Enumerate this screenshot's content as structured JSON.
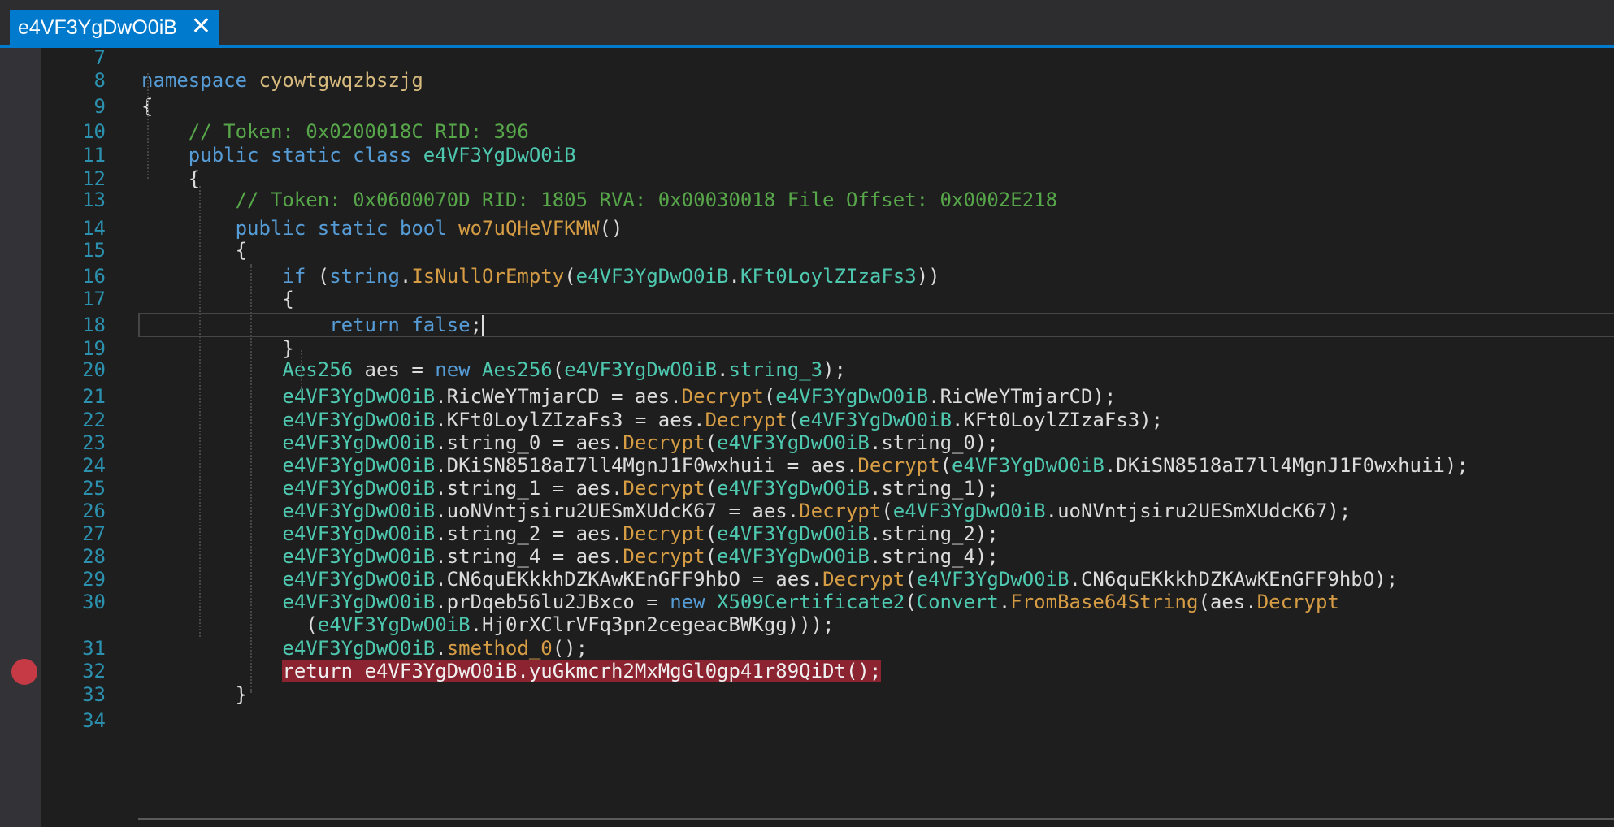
{
  "tab": {
    "title": "e4VF3YgDwO0iB",
    "close_glyph": "✕"
  },
  "editor": {
    "current_line": "18",
    "breakpoint_line": "32",
    "lines": [
      {
        "n": "7",
        "tokens": []
      },
      {
        "n": "8",
        "tokens": [
          [
            "kw",
            "namespace "
          ],
          [
            "ns",
            "cyowtgwqzbszjg"
          ]
        ]
      },
      {
        "n": "9",
        "tokens": [
          [
            "pl",
            "{"
          ]
        ]
      },
      {
        "n": "10",
        "tokens": [
          [
            "pl",
            "    "
          ],
          [
            "cm",
            "// Token: 0x0200018C RID: 396"
          ]
        ]
      },
      {
        "n": "11",
        "tokens": [
          [
            "pl",
            "    "
          ],
          [
            "kw",
            "public static class "
          ],
          [
            "ty",
            "e4VF3YgDwO0iB"
          ]
        ]
      },
      {
        "n": "12",
        "tokens": [
          [
            "pl",
            "    {"
          ]
        ]
      },
      {
        "n": "13",
        "tokens": [
          [
            "pl",
            "        "
          ],
          [
            "cm",
            "// Token: 0x0600070D RID: 1805 RVA: 0x00030018 File Offset: 0x0002E218"
          ]
        ]
      },
      {
        "n": "14",
        "tokens": [
          [
            "pl",
            "        "
          ],
          [
            "kw",
            "public static bool "
          ],
          [
            "mt",
            "wo7uQHeVFKMW"
          ],
          [
            "pl",
            "()"
          ]
        ]
      },
      {
        "n": "15",
        "tokens": [
          [
            "pl",
            "        {"
          ]
        ]
      },
      {
        "n": "16",
        "tokens": [
          [
            "pl",
            "            "
          ],
          [
            "kw",
            "if "
          ],
          [
            "pl",
            "("
          ],
          [
            "kw",
            "string"
          ],
          [
            "pl",
            "."
          ],
          [
            "mt",
            "IsNullOrEmpty"
          ],
          [
            "pl",
            "("
          ],
          [
            "ty",
            "e4VF3YgDwO0iB"
          ],
          [
            "pl",
            "."
          ],
          [
            "ty",
            "KFt0LoylZIzaFs3"
          ],
          [
            "pl",
            "))"
          ]
        ]
      },
      {
        "n": "17",
        "tokens": [
          [
            "pl",
            "            {"
          ]
        ]
      },
      {
        "n": "18",
        "tokens": [
          [
            "pl",
            "                "
          ],
          [
            "kw",
            "return false"
          ],
          [
            "pl",
            ";"
          ]
        ],
        "caret": true
      },
      {
        "n": "19",
        "tokens": [
          [
            "pl",
            "            }"
          ]
        ]
      },
      {
        "n": "20",
        "tokens": [
          [
            "pl",
            "            "
          ],
          [
            "ty",
            "Aes256"
          ],
          [
            "pl",
            " aes = "
          ],
          [
            "kw",
            "new "
          ],
          [
            "ty",
            "Aes256"
          ],
          [
            "pl",
            "("
          ],
          [
            "ty",
            "e4VF3YgDwO0iB"
          ],
          [
            "pl",
            "."
          ],
          [
            "ty",
            "string_3"
          ],
          [
            "pl",
            ");"
          ]
        ]
      },
      {
        "n": "21",
        "tokens": [
          [
            "pl",
            "            "
          ],
          [
            "ty",
            "e4VF3YgDwO0iB"
          ],
          [
            "pl",
            ".RicWeYTmjarCD = aes."
          ],
          [
            "mt",
            "Decrypt"
          ],
          [
            "pl",
            "("
          ],
          [
            "ty",
            "e4VF3YgDwO0iB"
          ],
          [
            "pl",
            ".RicWeYTmjarCD);"
          ]
        ]
      },
      {
        "n": "22",
        "tokens": [
          [
            "pl",
            "            "
          ],
          [
            "ty",
            "e4VF3YgDwO0iB"
          ],
          [
            "pl",
            ".KFt0LoylZIzaFs3 = aes."
          ],
          [
            "mt",
            "Decrypt"
          ],
          [
            "pl",
            "("
          ],
          [
            "ty",
            "e4VF3YgDwO0iB"
          ],
          [
            "pl",
            ".KFt0LoylZIzaFs3);"
          ]
        ]
      },
      {
        "n": "23",
        "tokens": [
          [
            "pl",
            "            "
          ],
          [
            "ty",
            "e4VF3YgDwO0iB"
          ],
          [
            "pl",
            ".string_0 = aes."
          ],
          [
            "mt",
            "Decrypt"
          ],
          [
            "pl",
            "("
          ],
          [
            "ty",
            "e4VF3YgDwO0iB"
          ],
          [
            "pl",
            ".string_0);"
          ]
        ]
      },
      {
        "n": "24",
        "tokens": [
          [
            "pl",
            "            "
          ],
          [
            "ty",
            "e4VF3YgDwO0iB"
          ],
          [
            "pl",
            ".DKiSN8518aI7ll4MgnJ1F0wxhuii = aes."
          ],
          [
            "mt",
            "Decrypt"
          ],
          [
            "pl",
            "("
          ],
          [
            "ty",
            "e4VF3YgDwO0iB"
          ],
          [
            "pl",
            ".DKiSN8518aI7ll4MgnJ1F0wxhuii);"
          ]
        ]
      },
      {
        "n": "25",
        "tokens": [
          [
            "pl",
            "            "
          ],
          [
            "ty",
            "e4VF3YgDwO0iB"
          ],
          [
            "pl",
            ".string_1 = aes."
          ],
          [
            "mt",
            "Decrypt"
          ],
          [
            "pl",
            "("
          ],
          [
            "ty",
            "e4VF3YgDwO0iB"
          ],
          [
            "pl",
            ".string_1);"
          ]
        ]
      },
      {
        "n": "26",
        "tokens": [
          [
            "pl",
            "            "
          ],
          [
            "ty",
            "e4VF3YgDwO0iB"
          ],
          [
            "pl",
            ".uoNVntjsiru2UESmXUdcK67 = aes."
          ],
          [
            "mt",
            "Decrypt"
          ],
          [
            "pl",
            "("
          ],
          [
            "ty",
            "e4VF3YgDwO0iB"
          ],
          [
            "pl",
            ".uoNVntjsiru2UESmXUdcK67);"
          ]
        ]
      },
      {
        "n": "27",
        "tokens": [
          [
            "pl",
            "            "
          ],
          [
            "ty",
            "e4VF3YgDwO0iB"
          ],
          [
            "pl",
            ".string_2 = aes."
          ],
          [
            "mt",
            "Decrypt"
          ],
          [
            "pl",
            "("
          ],
          [
            "ty",
            "e4VF3YgDwO0iB"
          ],
          [
            "pl",
            ".string_2);"
          ]
        ]
      },
      {
        "n": "28",
        "tokens": [
          [
            "pl",
            "            "
          ],
          [
            "ty",
            "e4VF3YgDwO0iB"
          ],
          [
            "pl",
            ".string_4 = aes."
          ],
          [
            "mt",
            "Decrypt"
          ],
          [
            "pl",
            "("
          ],
          [
            "ty",
            "e4VF3YgDwO0iB"
          ],
          [
            "pl",
            ".string_4);"
          ]
        ]
      },
      {
        "n": "29",
        "tokens": [
          [
            "pl",
            "            "
          ],
          [
            "ty",
            "e4VF3YgDwO0iB"
          ],
          [
            "pl",
            ".CN6quEKkkhDZKAwKEnGFF9hbO = aes."
          ],
          [
            "mt",
            "Decrypt"
          ],
          [
            "pl",
            "("
          ],
          [
            "ty",
            "e4VF3YgDwO0iB"
          ],
          [
            "pl",
            ".CN6quEKkkhDZKAwKEnGFF9hbO);"
          ]
        ]
      },
      {
        "n": "30",
        "tokens": [
          [
            "pl",
            "            "
          ],
          [
            "ty",
            "e4VF3YgDwO0iB"
          ],
          [
            "pl",
            ".prDqeb56lu2JBxco = "
          ],
          [
            "kw",
            "new "
          ],
          [
            "ty",
            "X509Certificate2"
          ],
          [
            "pl",
            "("
          ],
          [
            "ty",
            "Convert"
          ],
          [
            "pl",
            "."
          ],
          [
            "mt",
            "FromBase64String"
          ],
          [
            "pl",
            "(aes."
          ],
          [
            "mt",
            "Decrypt"
          ]
        ]
      },
      {
        "n": "",
        "tokens": [
          [
            "pl",
            "              ("
          ],
          [
            "ty",
            "e4VF3YgDwO0iB"
          ],
          [
            "pl",
            ".Hj0rXClrVFq3pn2cegeacBWKgg)));"
          ]
        ]
      },
      {
        "n": "31",
        "tokens": [
          [
            "pl",
            "            "
          ],
          [
            "ty",
            "e4VF3YgDwO0iB"
          ],
          [
            "pl",
            "."
          ],
          [
            "mt",
            "smethod_0"
          ],
          [
            "pl",
            "();"
          ]
        ]
      },
      {
        "n": "32",
        "tokens": [
          [
            "pl",
            "            "
          ],
          [
            "hl",
            "return e4VF3YgDwO0iB.yuGkmcrh2MxMgGl0gp41r89QiDt();"
          ]
        ],
        "breakpoint": true
      },
      {
        "n": "33",
        "tokens": [
          [
            "pl",
            "        }"
          ]
        ]
      },
      {
        "n": "34",
        "tokens": []
      }
    ]
  }
}
